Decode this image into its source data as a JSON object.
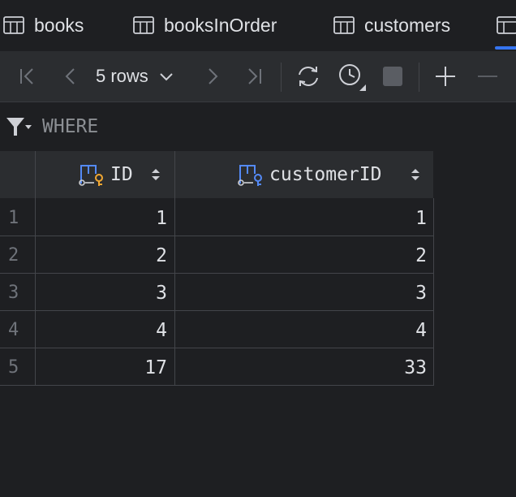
{
  "tabs": [
    {
      "label": "books",
      "icon": "table-icon"
    },
    {
      "label": "booksInOrder",
      "icon": "table-icon"
    },
    {
      "label": "customers",
      "icon": "table-icon"
    }
  ],
  "toolbar": {
    "rows_label": "5 rows"
  },
  "filter": {
    "where_placeholder": "WHERE"
  },
  "table": {
    "columns": [
      {
        "name": "ID",
        "icon": "key-column-icon"
      },
      {
        "name": "customerID",
        "icon": "key-column-icon"
      }
    ],
    "rows": [
      {
        "num": "1",
        "ID": "1",
        "customerID": "1"
      },
      {
        "num": "2",
        "ID": "2",
        "customerID": "2"
      },
      {
        "num": "3",
        "ID": "3",
        "customerID": "3"
      },
      {
        "num": "4",
        "ID": "4",
        "customerID": "4"
      },
      {
        "num": "5",
        "ID": "17",
        "customerID": "33"
      }
    ]
  },
  "colors": {
    "accent": "#3574f0",
    "key_primary": "#f0a732",
    "key_foreign": "#548af7"
  }
}
